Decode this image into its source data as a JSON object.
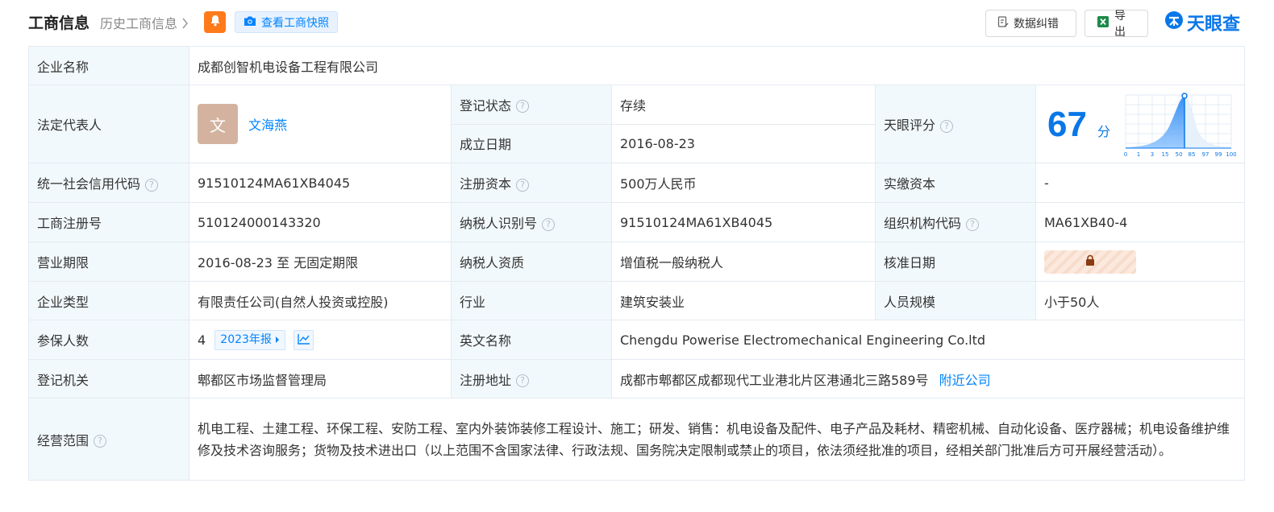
{
  "header": {
    "title": "工商信息",
    "history_link": "历史工商信息",
    "snapshot_button": "查看工商快照",
    "correction_button": "数据纠错",
    "export_button": "导出",
    "logo_text": "天眼查"
  },
  "colors": {
    "brand_blue": "#0084ff",
    "label_bg": "#f2f9fc",
    "status_green": "#1fa64a",
    "bell_orange": "#ff7a1a"
  },
  "company": {
    "name_label": "企业名称",
    "name": "成都创智机电设备工程有限公司",
    "legal_rep_label": "法定代表人",
    "legal_rep_avatar": "文",
    "legal_rep": "文海燕",
    "status_label": "登记状态",
    "status": "存续",
    "established_label": "成立日期",
    "established": "2016-08-23",
    "score_label": "天眼评分",
    "score": "67",
    "score_unit": "分",
    "score_axis_ticks": [
      "0",
      "1",
      "3",
      "15",
      "50",
      "85",
      "97",
      "99",
      "100"
    ],
    "credit_code_label": "统一社会信用代码",
    "credit_code": "91510124MA61XB4045",
    "reg_capital_label": "注册资本",
    "reg_capital": "500万人民币",
    "paid_capital_label": "实缴资本",
    "paid_capital": "-",
    "reg_no_label": "工商注册号",
    "reg_no": "510124000143320",
    "taxpayer_id_label": "纳税人识别号",
    "taxpayer_id": "91510124MA61XB4045",
    "org_code_label": "组织机构代码",
    "org_code": "MA61XB40-4",
    "term_label": "营业期限",
    "term": "2016-08-23 至 无固定期限",
    "taxpayer_qual_label": "纳税人资质",
    "taxpayer_qual": "增值税一般纳税人",
    "approval_date_label": "核准日期",
    "type_label": "企业类型",
    "type": "有限责任公司(自然人投资或控股)",
    "industry_label": "行业",
    "industry": "建筑安装业",
    "staff_label": "人员规模",
    "staff": "小于50人",
    "insured_label": "参保人数",
    "insured": "4",
    "insured_year_button": "2023年报",
    "english_name_label": "英文名称",
    "english_name": "Chengdu Powerise Electromechanical Engineering Co.ltd",
    "authority_label": "登记机关",
    "authority": "郫都区市场监督管理局",
    "address_label": "注册地址",
    "address": "成都市郫都区成都现代工业港北片区港通北三路589号",
    "nearby_link": "附近公司",
    "scope_label": "经营范围",
    "scope": "机电工程、土建工程、环保工程、安防工程、室内外装饰装修工程设计、施工；研发、销售：机电设备及配件、电子产品及耗材、精密机械、自动化设备、医疗器械；机电设备维护维修及技术咨询服务；货物及技术进出口（以上范围不含国家法律、行政法规、国务院决定限制或禁止的项目，依法须经批准的项目，经相关部门批准后方可开展经营活动）。"
  }
}
